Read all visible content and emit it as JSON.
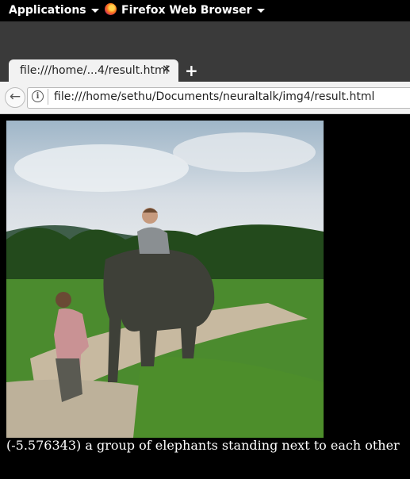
{
  "topbar": {
    "applications_label": "Applications",
    "app_label": "Firefox Web Browser"
  },
  "tab": {
    "title": "file:///home/...4/result.html",
    "close": "×",
    "new_tab": "+"
  },
  "navbar": {
    "back": "←",
    "info": "i",
    "url": "file:///home/sethu/Documents/neuraltalk/img4/result.html"
  },
  "content": {
    "caption": "(-5.576343) a group of elephants standing next to each other"
  }
}
